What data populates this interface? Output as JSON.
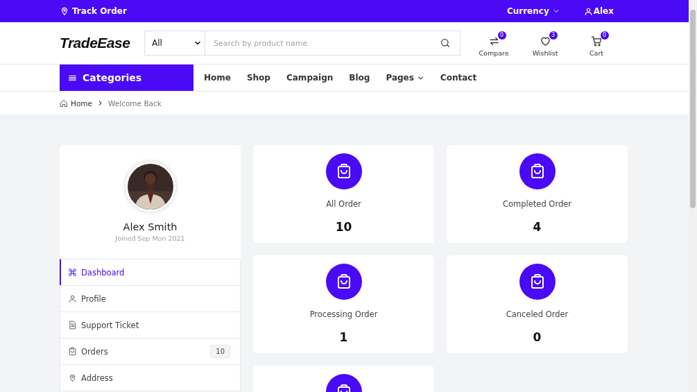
{
  "top_bar": {
    "track_order": "Track Order",
    "currency": "Currency",
    "user": "Alex"
  },
  "header": {
    "logo": "TradeEase",
    "category_select": "All",
    "search": {
      "placeholder": "Search by product name"
    },
    "actions": [
      {
        "kind": "compare",
        "label": "Compare",
        "count": "0"
      },
      {
        "kind": "wishlist",
        "label": "Wishlist",
        "count": "3"
      },
      {
        "kind": "cart",
        "label": "Cart",
        "count": "0"
      }
    ]
  },
  "nav": {
    "categories": "Categories",
    "links": [
      {
        "label": "Home",
        "dropdown": false
      },
      {
        "label": "Shop",
        "dropdown": false
      },
      {
        "label": "Campaign",
        "dropdown": false
      },
      {
        "label": "Blog",
        "dropdown": false
      },
      {
        "label": "Pages",
        "dropdown": true
      },
      {
        "label": "Contact",
        "dropdown": false
      }
    ]
  },
  "breadcrumb": [
    "Home",
    "Welcome Back"
  ],
  "profile": {
    "name": "Alex Smith",
    "joined": "Joined Sep Mon 2021"
  },
  "menu": [
    {
      "kind": "dashboard",
      "label": "Dashboard",
      "selected": true
    },
    {
      "kind": "profile",
      "label": "Profile",
      "selected": false
    },
    {
      "kind": "ticket",
      "label": "Support Ticket",
      "selected": false
    },
    {
      "kind": "orders",
      "label": "Orders",
      "badge": "10",
      "selected": false
    },
    {
      "kind": "address",
      "label": "Address",
      "selected": false
    }
  ],
  "stats": [
    {
      "kind": "stat",
      "label": "All Order",
      "value": "10"
    },
    {
      "kind": "stat",
      "label": "Completed Order",
      "value": "4"
    },
    {
      "kind": "stat",
      "label": "Processing Order",
      "value": "1"
    },
    {
      "kind": "stat",
      "label": "Canceled Order",
      "value": "0"
    },
    {
      "kind": "partial"
    }
  ]
}
